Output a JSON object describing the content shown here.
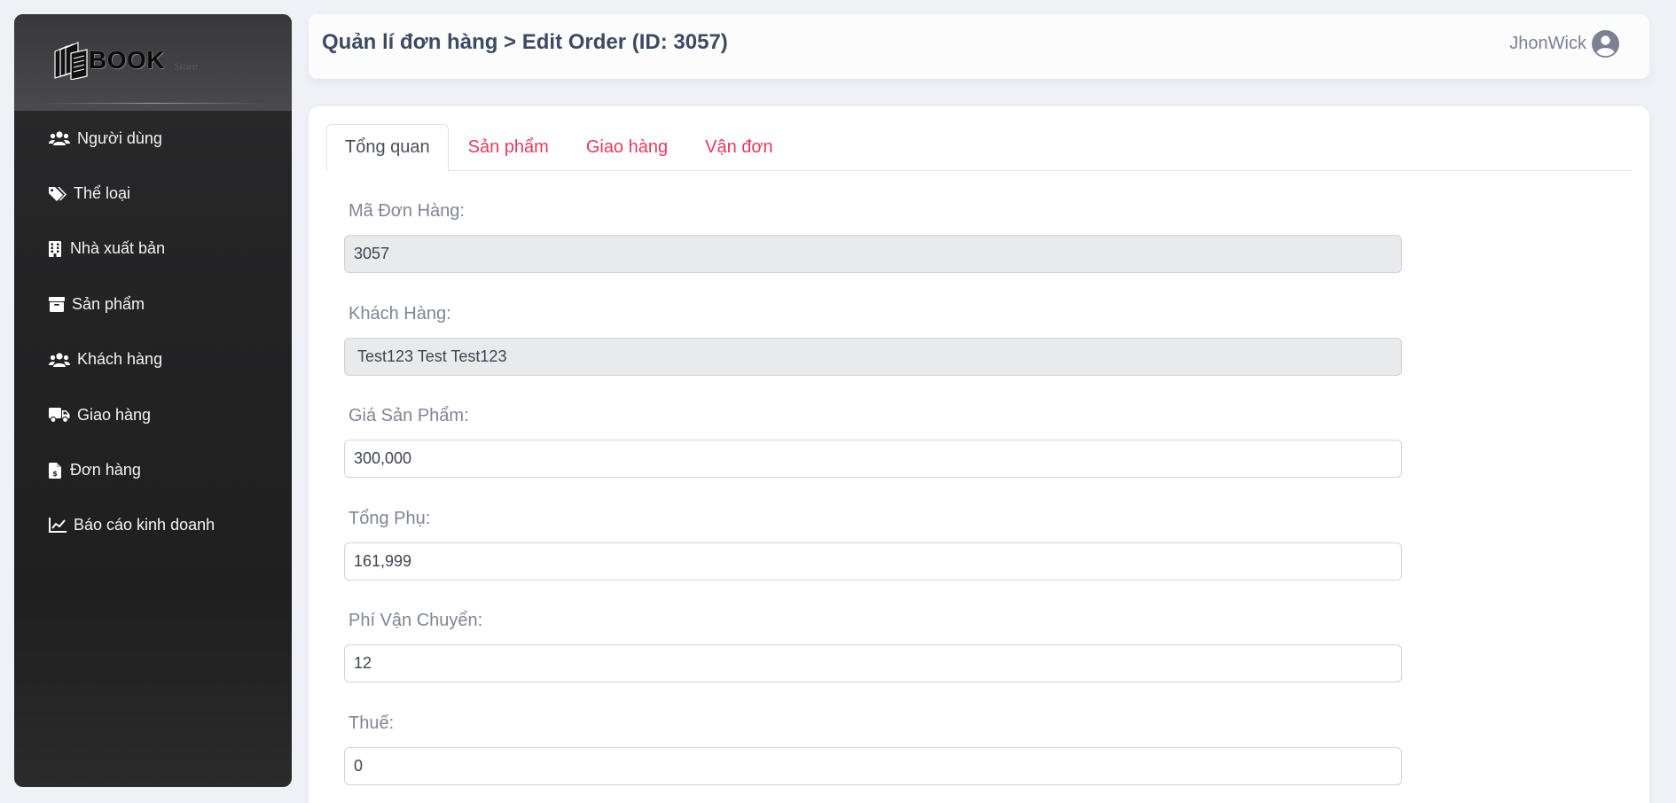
{
  "brand": {
    "logo_text": "BOOK",
    "logo_sub": "Store"
  },
  "sidebar": {
    "items": [
      {
        "label": "Người dùng",
        "icon": "users-icon"
      },
      {
        "label": "Thể loại",
        "icon": "tags-icon"
      },
      {
        "label": "Nhà xuất bản",
        "icon": "building-icon"
      },
      {
        "label": "Sản phẩm",
        "icon": "box-icon"
      },
      {
        "label": "Khách hàng",
        "icon": "users-icon"
      },
      {
        "label": "Giao hàng",
        "icon": "truck-icon"
      },
      {
        "label": "Đơn hàng",
        "icon": "invoice-icon"
      },
      {
        "label": "Báo cáo kinh doanh",
        "icon": "chart-line-icon"
      }
    ]
  },
  "header": {
    "title": "Quản lí đơn hàng > Edit Order (ID: 3057)",
    "username": "JhonWick",
    "avatar_icon": "user-circle-icon"
  },
  "tabs": [
    {
      "label": "Tổng quan",
      "active": true
    },
    {
      "label": "Sản phẩm",
      "active": false
    },
    {
      "label": "Giao hàng",
      "active": false
    },
    {
      "label": "Vận đơn",
      "active": false
    }
  ],
  "form": {
    "order_id": {
      "label": "Mã Đơn Hàng:",
      "value": "3057",
      "readonly": true
    },
    "customer": {
      "label": "Khách Hàng:",
      "value": "Test123 Test Test123",
      "readonly": true
    },
    "product_price": {
      "label": "Giá Sản Phẩm:",
      "value": "300,000"
    },
    "subtotal": {
      "label": "Tổng Phụ:",
      "value": "161,999"
    },
    "shipping_fee": {
      "label": "Phí Vận Chuyển:",
      "value": "12"
    },
    "tax": {
      "label": "Thuế:",
      "value": "0"
    }
  },
  "colors": {
    "sidebar_bg": "#232324",
    "tab_link": "#e8395d",
    "title": "#3e4a63",
    "page_bg": "#eff1f6"
  }
}
